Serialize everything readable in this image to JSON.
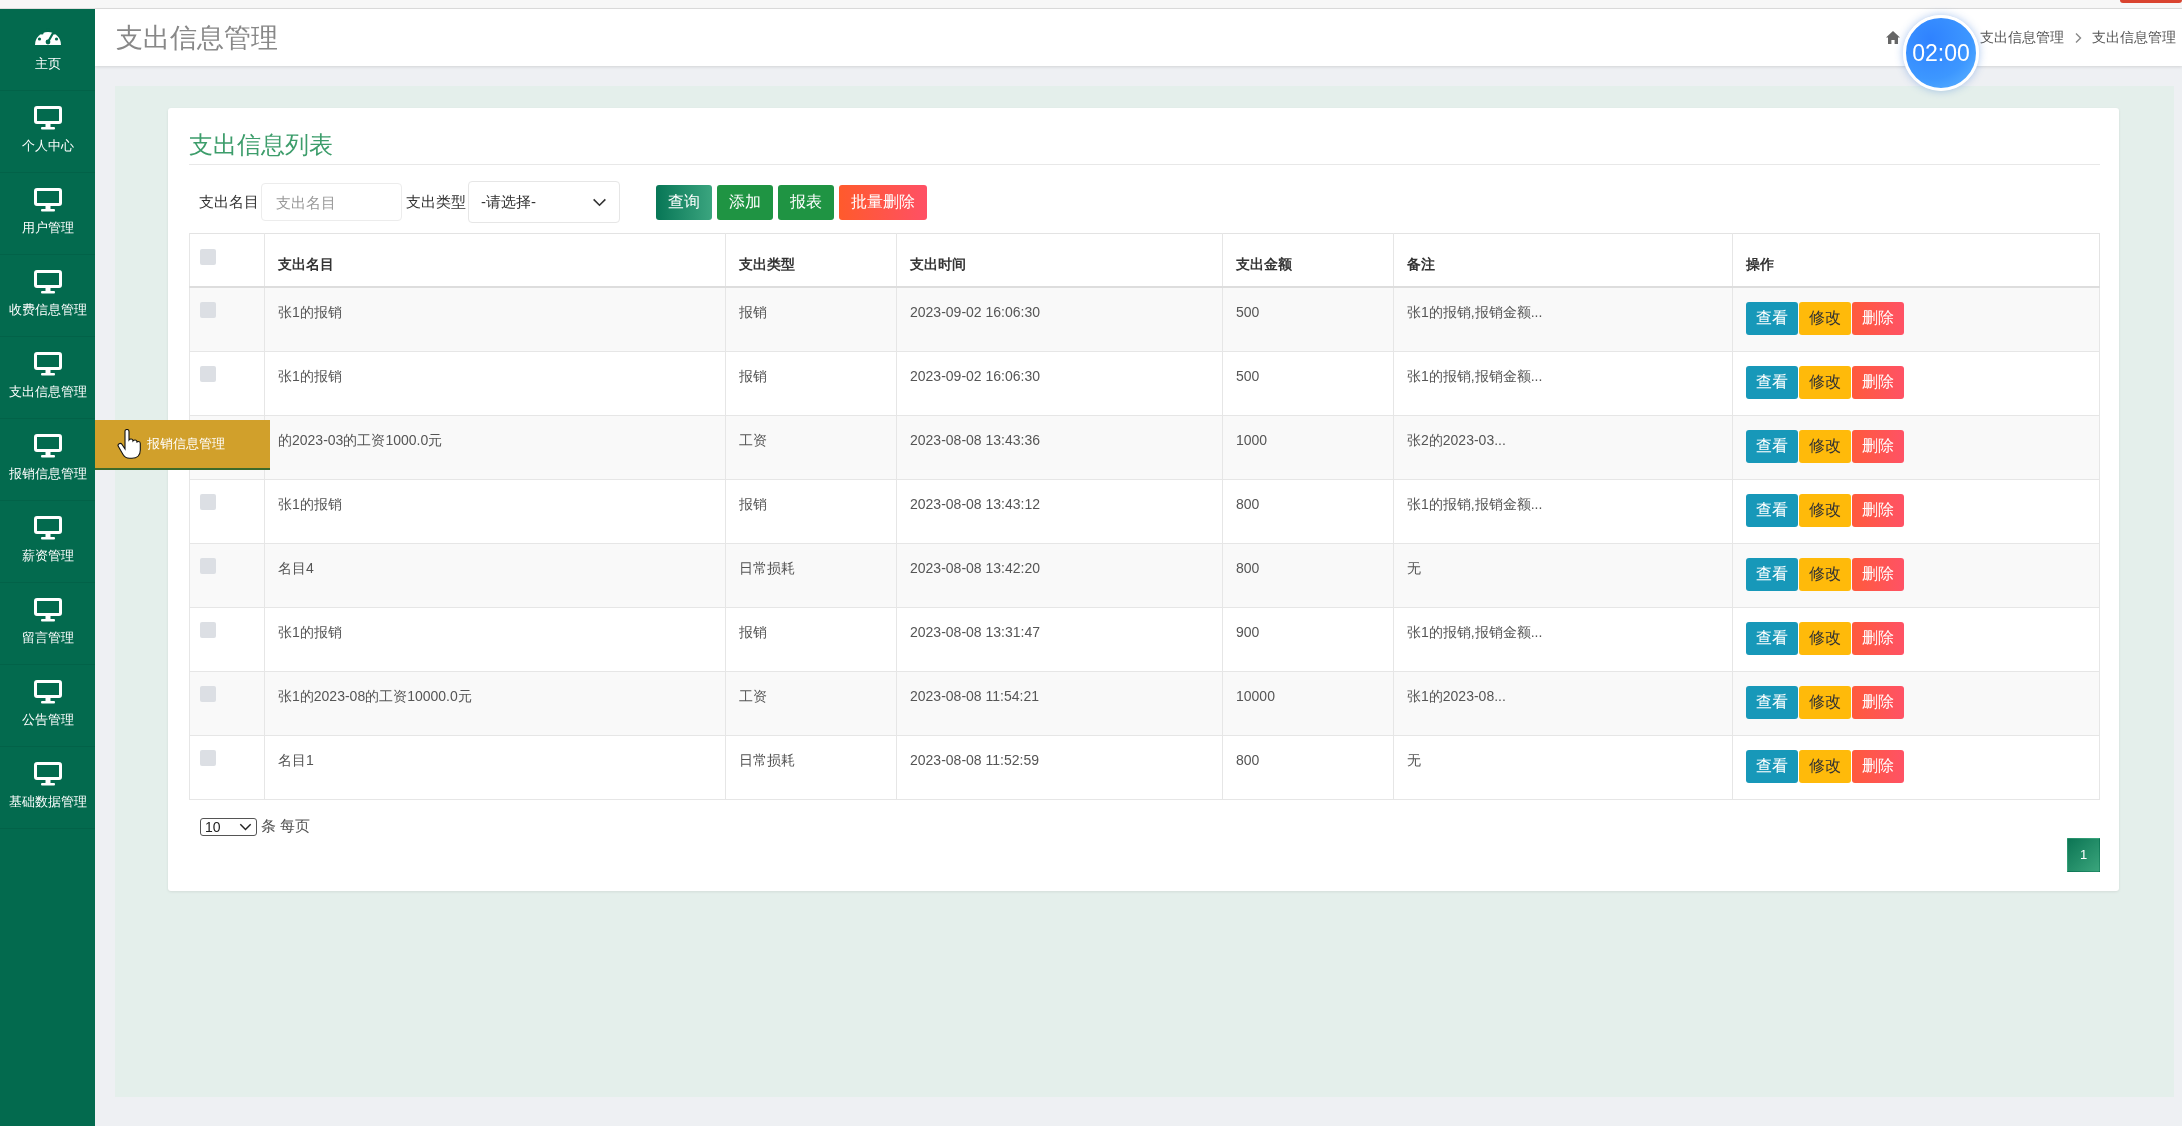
{
  "sidebar": {
    "items": [
      {
        "label": "主页",
        "kind": "home"
      },
      {
        "label": "个人中心",
        "kind": "module"
      },
      {
        "label": "用户管理",
        "kind": "module"
      },
      {
        "label": "收费信息管理",
        "kind": "module"
      },
      {
        "label": "支出信息管理",
        "kind": "module"
      },
      {
        "label": "报销信息管理",
        "kind": "module",
        "tooltip": "报销信息管理"
      },
      {
        "label": "薪资管理",
        "kind": "module"
      },
      {
        "label": "留言管理",
        "kind": "module"
      },
      {
        "label": "公告管理",
        "kind": "module"
      },
      {
        "label": "基础数据管理",
        "kind": "module"
      }
    ]
  },
  "header": {
    "title": "支出信息管理",
    "breadcrumb": [
      "支出信息管理",
      "支出信息管理"
    ],
    "timer": "02:00"
  },
  "card": {
    "title": "支出信息列表",
    "filters": [
      {
        "kind": "text",
        "label": "支出名目",
        "placeholder": "支出名目"
      },
      {
        "kind": "select",
        "label": "支出类型",
        "value": "-请选择-"
      }
    ],
    "buttons": [
      {
        "label": "查询",
        "kind": "search"
      },
      {
        "label": "添加",
        "kind": "add"
      },
      {
        "label": "报表",
        "kind": "report"
      },
      {
        "label": "批量删除",
        "kind": "delete"
      }
    ]
  },
  "table": {
    "select_all": {
      "checked": false
    },
    "columns": [
      "支出名目",
      "支出类型",
      "支出时间",
      "支出金额",
      "备注",
      "操作"
    ],
    "rows": [
      {
        "checked": false,
        "cells": [
          "张1的报销",
          "报销",
          "2023-09-02 16:06:30",
          "500",
          "张1的报销,报销金额..."
        ],
        "actions": [
          {
            "label": "查看",
            "kind": "view"
          },
          {
            "label": "修改",
            "kind": "edit"
          },
          {
            "label": "删除",
            "kind": "delete"
          }
        ]
      },
      {
        "checked": false,
        "cells": [
          "张1的报销",
          "报销",
          "2023-09-02 16:06:30",
          "500",
          "张1的报销,报销金额..."
        ],
        "actions": [
          {
            "label": "查看",
            "kind": "view"
          },
          {
            "label": "修改",
            "kind": "edit"
          },
          {
            "label": "删除",
            "kind": "delete"
          }
        ]
      },
      {
        "cells": [
          "的2023-03的工资1000.0元",
          "工资",
          "2023-08-08 13:43:36",
          "1000",
          "张2的2023-03..."
        ],
        "actions": [
          {
            "label": "查看",
            "kind": "view"
          },
          {
            "label": "修改",
            "kind": "edit"
          },
          {
            "label": "删除",
            "kind": "delete"
          }
        ]
      },
      {
        "checked": false,
        "cells": [
          "张1的报销",
          "报销",
          "2023-08-08 13:43:12",
          "800",
          "张1的报销,报销金额..."
        ],
        "actions": [
          {
            "label": "查看",
            "kind": "view"
          },
          {
            "label": "修改",
            "kind": "edit"
          },
          {
            "label": "删除",
            "kind": "delete"
          }
        ]
      },
      {
        "checked": false,
        "cells": [
          "名目4",
          "日常损耗",
          "2023-08-08 13:42:20",
          "800",
          "无"
        ],
        "actions": [
          {
            "label": "查看",
            "kind": "view"
          },
          {
            "label": "修改",
            "kind": "edit"
          },
          {
            "label": "删除",
            "kind": "delete"
          }
        ]
      },
      {
        "checked": false,
        "cells": [
          "张1的报销",
          "报销",
          "2023-08-08 13:31:47",
          "900",
          "张1的报销,报销金额..."
        ],
        "actions": [
          {
            "label": "查看",
            "kind": "view"
          },
          {
            "label": "修改",
            "kind": "edit"
          },
          {
            "label": "删除",
            "kind": "delete"
          }
        ]
      },
      {
        "checked": false,
        "cells": [
          "张1的2023-08的工资10000.0元",
          "工资",
          "2023-08-08 11:54:21",
          "10000",
          "张1的2023-08..."
        ],
        "actions": [
          {
            "label": "查看",
            "kind": "view"
          },
          {
            "label": "修改",
            "kind": "edit"
          },
          {
            "label": "删除",
            "kind": "delete"
          }
        ]
      },
      {
        "checked": false,
        "cells": [
          "名目1",
          "日常损耗",
          "2023-08-08 11:52:59",
          "800",
          "无"
        ],
        "actions": [
          {
            "label": "查看",
            "kind": "view"
          },
          {
            "label": "修改",
            "kind": "edit"
          },
          {
            "label": "删除",
            "kind": "delete"
          }
        ]
      }
    ]
  },
  "pagination": {
    "page_size": "10",
    "page_size_suffix": "条 每页",
    "pages": [
      {
        "label": "1",
        "selected": true
      }
    ]
  }
}
